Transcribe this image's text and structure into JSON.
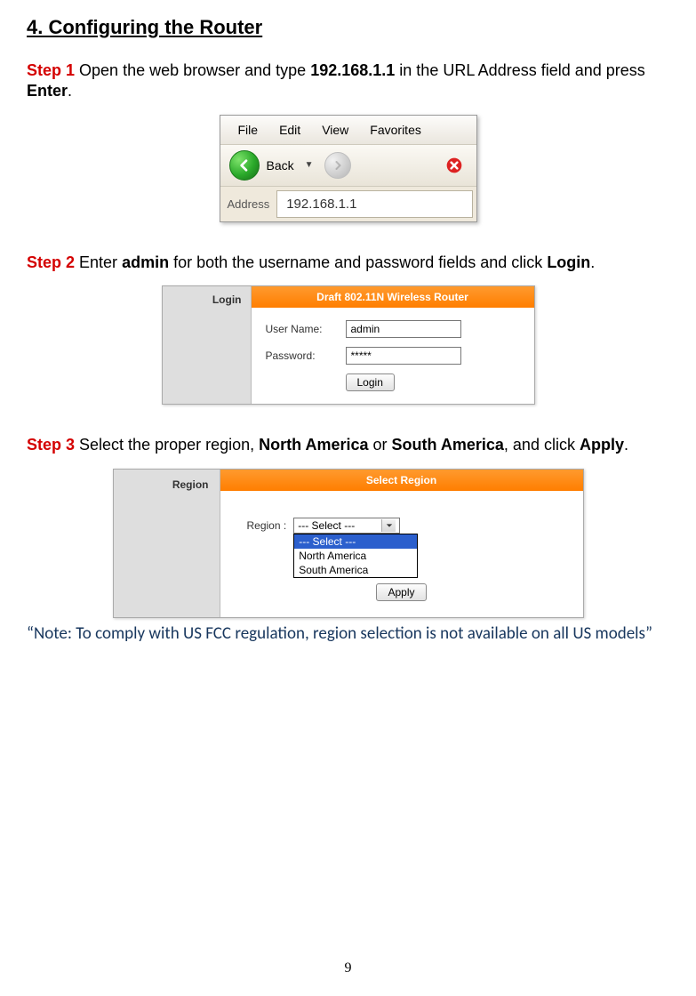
{
  "title": "4. Configuring the Router",
  "page_number": "9",
  "step1": {
    "label": "Step 1",
    "t1": " Open the web browser and type ",
    "ip": "192.168.1.1",
    "t2": " in the URL Address field and press ",
    "enter": "Enter",
    "t3": "."
  },
  "step2": {
    "label": "Step 2",
    "t1": " Enter ",
    "admin": "admin",
    "t2": " for both the username and password fields and click ",
    "login": "Login",
    "t3": "."
  },
  "step3": {
    "label": "Step 3",
    "t1": " Select the proper region, ",
    "na": "North America",
    "t2": " or ",
    "sa": "South America",
    "t3": ", and click ",
    "apply": "Apply",
    "t4": "."
  },
  "note": "“Note: To comply with US FCC regulation, region selection is not available on all US models”",
  "fig1": {
    "menu": {
      "file": "File",
      "edit": "Edit",
      "view": "View",
      "favorites": "Favorites"
    },
    "back_label": "Back",
    "addr_label": "Address",
    "addr_value": "192.168.1.1"
  },
  "fig2": {
    "side_label": "Login",
    "header": "Draft 802.11N Wireless Router",
    "user_label": "User Name:",
    "pass_label": "Password:",
    "user_value": "admin",
    "pass_value": "*****",
    "login_btn": "Login"
  },
  "fig3": {
    "side_label": "Region",
    "header": "Select Region",
    "region_label": "Region :",
    "selected": "--- Select ---",
    "opt0": "--- Select ---",
    "opt1": "North America",
    "opt2": "South America",
    "apply_btn": "Apply"
  }
}
